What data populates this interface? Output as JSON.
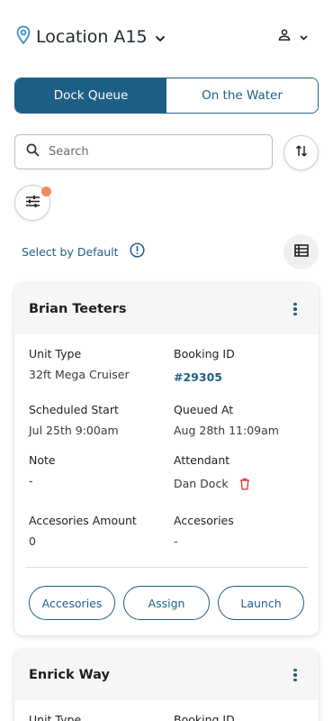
{
  "header": {
    "location": "Location A15",
    "icons": {
      "location": "map-pin-icon",
      "dropdown": "chevron-down-icon",
      "user": "user-icon"
    }
  },
  "tabs": [
    {
      "label": "Dock Queue",
      "active": true
    },
    {
      "label": "On the Water",
      "active": false
    }
  ],
  "search": {
    "placeholder": "Search",
    "value": ""
  },
  "filter": {
    "has_indicator": true,
    "indicator_color": "#f08a5d"
  },
  "select_default": {
    "label": "Select by Default"
  },
  "colors": {
    "accent": "#1e5f86",
    "danger": "#e0443b"
  },
  "cards": [
    {
      "name": "Brian Teeters",
      "fields": {
        "unit_type": {
          "label": "Unit Type",
          "value": "32ft Mega Cruiser"
        },
        "booking_id": {
          "label": "Booking ID",
          "value": "#29305"
        },
        "scheduled_start": {
          "label": "Scheduled Start",
          "value": "Jul 25th 9:00am"
        },
        "queued_at": {
          "label": "Queued At",
          "value": "Aug 28th 11:09am"
        },
        "note": {
          "label": "Note",
          "value": "-"
        },
        "attendant": {
          "label": "Attendant",
          "value": "Dan Dock"
        },
        "accessories_amount": {
          "label": "Accesories Amount",
          "value": "0"
        },
        "accessories": {
          "label": "Accesories",
          "value": "-"
        }
      },
      "actions": [
        "Accesories",
        "Assign",
        "Launch"
      ]
    },
    {
      "name": "Enrick Way",
      "fields": {
        "unit_type": {
          "label": "Unit Type"
        },
        "booking_id": {
          "label": "Booking ID"
        }
      }
    }
  ]
}
